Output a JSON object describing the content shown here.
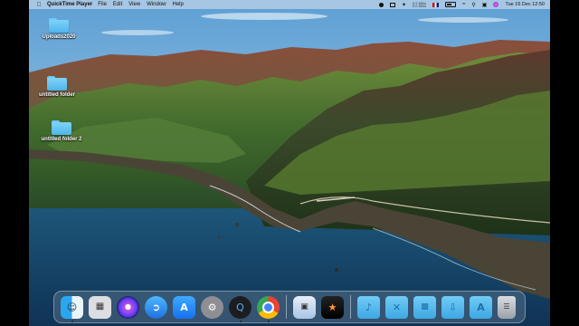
{
  "menubar": {
    "apple_icon": "apple-logo-icon",
    "app_name": "QuickTime Player",
    "menus": [
      "File",
      "Edit",
      "View",
      "Window",
      "Help"
    ],
    "status": {
      "net_speed": "0.2 KB/s\n0.0 KB/s",
      "date_time": "Tue 15 Dec  12:50"
    }
  },
  "desktop": {
    "items": [
      {
        "label": "Uploads2020"
      },
      {
        "label": "untitled folder"
      },
      {
        "label": "untitled folder 2"
      }
    ]
  },
  "dock": {
    "apps": [
      {
        "name": "Finder",
        "icon": "finder-icon"
      },
      {
        "name": "Launchpad",
        "icon": "launchpad-icon"
      },
      {
        "name": "Siri",
        "icon": "siri-icon"
      },
      {
        "name": "Safari",
        "icon": "safari-icon"
      },
      {
        "name": "App Store",
        "icon": "app-store-icon"
      },
      {
        "name": "System Preferences",
        "icon": "gear-icon"
      },
      {
        "name": "QuickTime Player",
        "icon": "quicktime-icon"
      },
      {
        "name": "Google Chrome",
        "icon": "chrome-icon"
      },
      {
        "name": "Preview",
        "icon": "preview-icon"
      },
      {
        "name": "Final Cut Pro",
        "icon": "final-cut-pro-icon"
      }
    ],
    "stacks": [
      {
        "name": "Music",
        "icon": "music-folder-icon"
      },
      {
        "name": "Utilities",
        "icon": "utilities-folder-icon"
      },
      {
        "name": "Pictures",
        "icon": "pictures-folder-icon"
      },
      {
        "name": "Downloads",
        "icon": "downloads-folder-icon"
      },
      {
        "name": "Applications",
        "icon": "applications-folder-icon"
      }
    ],
    "trash": {
      "name": "Trash",
      "icon": "trash-icon"
    }
  }
}
